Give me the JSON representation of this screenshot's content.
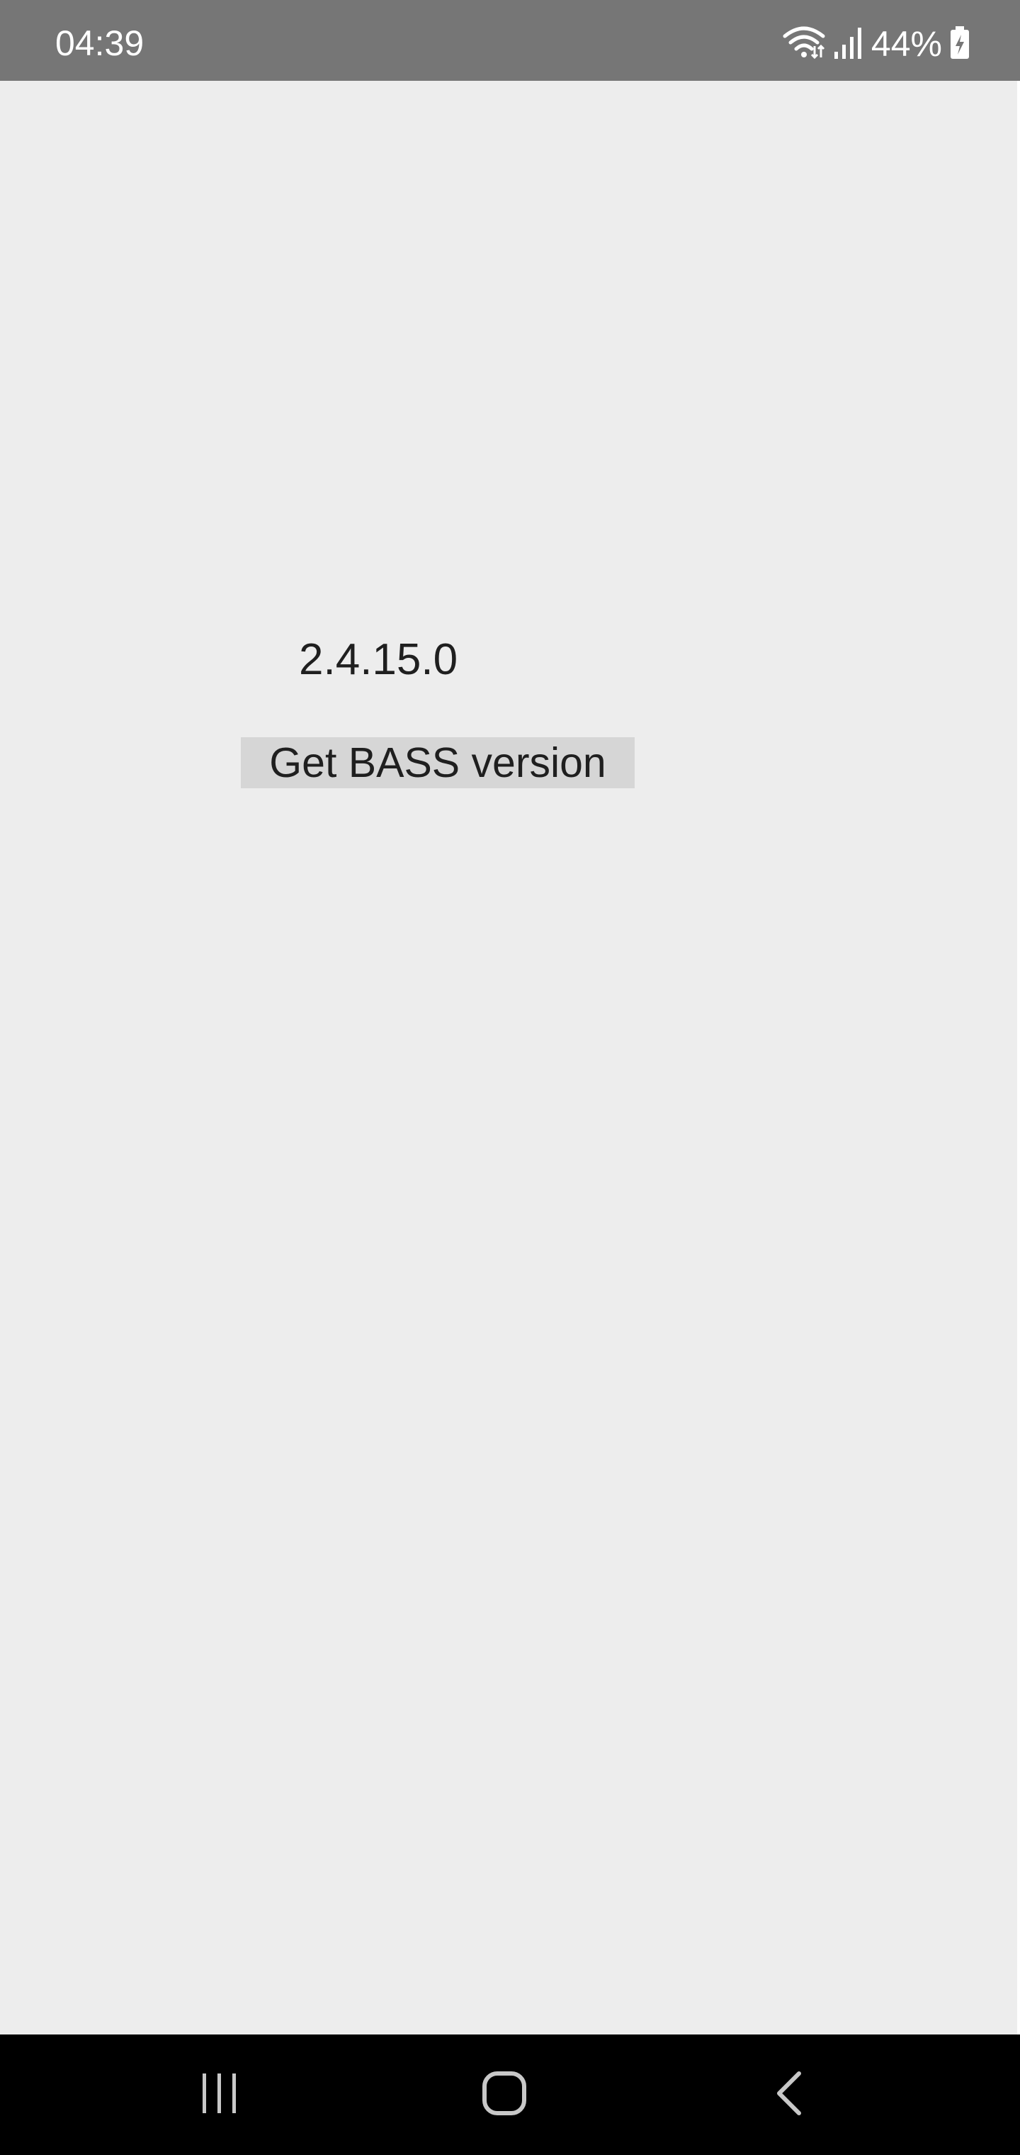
{
  "status_bar": {
    "time": "04:39",
    "battery_percent": "44%",
    "icons": [
      "wifi-icon",
      "signal-icon",
      "battery-charging-icon"
    ],
    "background_color": "#767676"
  },
  "main": {
    "version_text": "2.4.15.0",
    "button_label": "Get BASS version",
    "background_color": "#ededed"
  },
  "nav_bar": {
    "buttons": [
      "recent-apps-icon",
      "home-icon",
      "back-icon"
    ],
    "background_color": "#000000"
  }
}
